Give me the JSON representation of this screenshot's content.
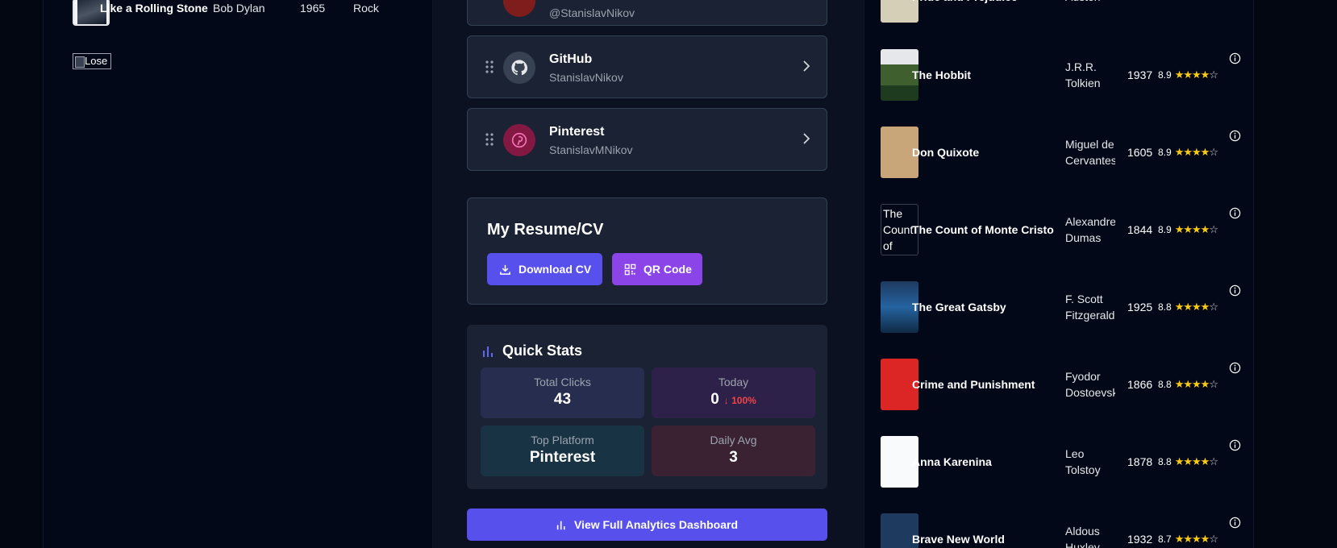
{
  "songs": {
    "row": {
      "title": "Like a Rolling Stone",
      "artist": "Bob Dylan",
      "year": "1965",
      "genre": "Rock"
    },
    "broken_image_alt": "Lose"
  },
  "links": {
    "partial_handle": "@StanislavNikov",
    "items": [
      {
        "name": "GitHub",
        "handle": "StanislavNikov",
        "icon": "github-icon",
        "icon_bg": "#374151"
      },
      {
        "name": "Pinterest",
        "handle": "StanislavMNikov",
        "icon": "pinterest-icon",
        "icon_bg": "#831843"
      }
    ]
  },
  "resume": {
    "title": "My Resume/CV",
    "download_label": "Download CV",
    "qr_label": "QR Code"
  },
  "stats": {
    "title": "Quick Stats",
    "total_clicks": {
      "label": "Total Clicks",
      "value": "43"
    },
    "today": {
      "label": "Today",
      "value": "0",
      "change": "↓ 100%"
    },
    "top_platform": {
      "label": "Top Platform",
      "value": "Pinterest"
    },
    "daily_avg": {
      "label": "Daily Avg",
      "value": "3"
    }
  },
  "analytics_button": "View Full Analytics Dashboard",
  "books": {
    "top_partial": {
      "title": "Pride and Prejudice",
      "author": "Austen"
    },
    "items": [
      {
        "title": "The Hobbit",
        "author": "J.R.R. Tolkien",
        "year": "1937",
        "rating": "8.9",
        "stars": 4
      },
      {
        "title": "Don Quixote",
        "author": "Miguel de Cervantes",
        "year": "1605",
        "rating": "8.9",
        "stars": 4
      },
      {
        "title": "The Count of Monte Cristo",
        "author": "Alexandre Dumas",
        "year": "1844",
        "rating": "8.9",
        "stars": 4,
        "cover_alt": "The Count of"
      },
      {
        "title": "The Great Gatsby",
        "author": "F. Scott Fitzgerald",
        "year": "1925",
        "rating": "8.8",
        "stars": 4
      },
      {
        "title": "Crime and Punishment",
        "author": "Fyodor Dostoevsky",
        "year": "1866",
        "rating": "8.8",
        "stars": 4
      },
      {
        "title": "Anna Karenina",
        "author": "Leo Tolstoy",
        "year": "1878",
        "rating": "8.8",
        "stars": 4
      },
      {
        "title": "Brave New World",
        "author": "Aldous Huxley",
        "year": "1932",
        "rating": "8.7",
        "stars": 4
      }
    ]
  },
  "colors": {
    "accent": "#5850ec",
    "purple": "#8b44e8",
    "star": "#facc15",
    "negative": "#ef4444"
  }
}
